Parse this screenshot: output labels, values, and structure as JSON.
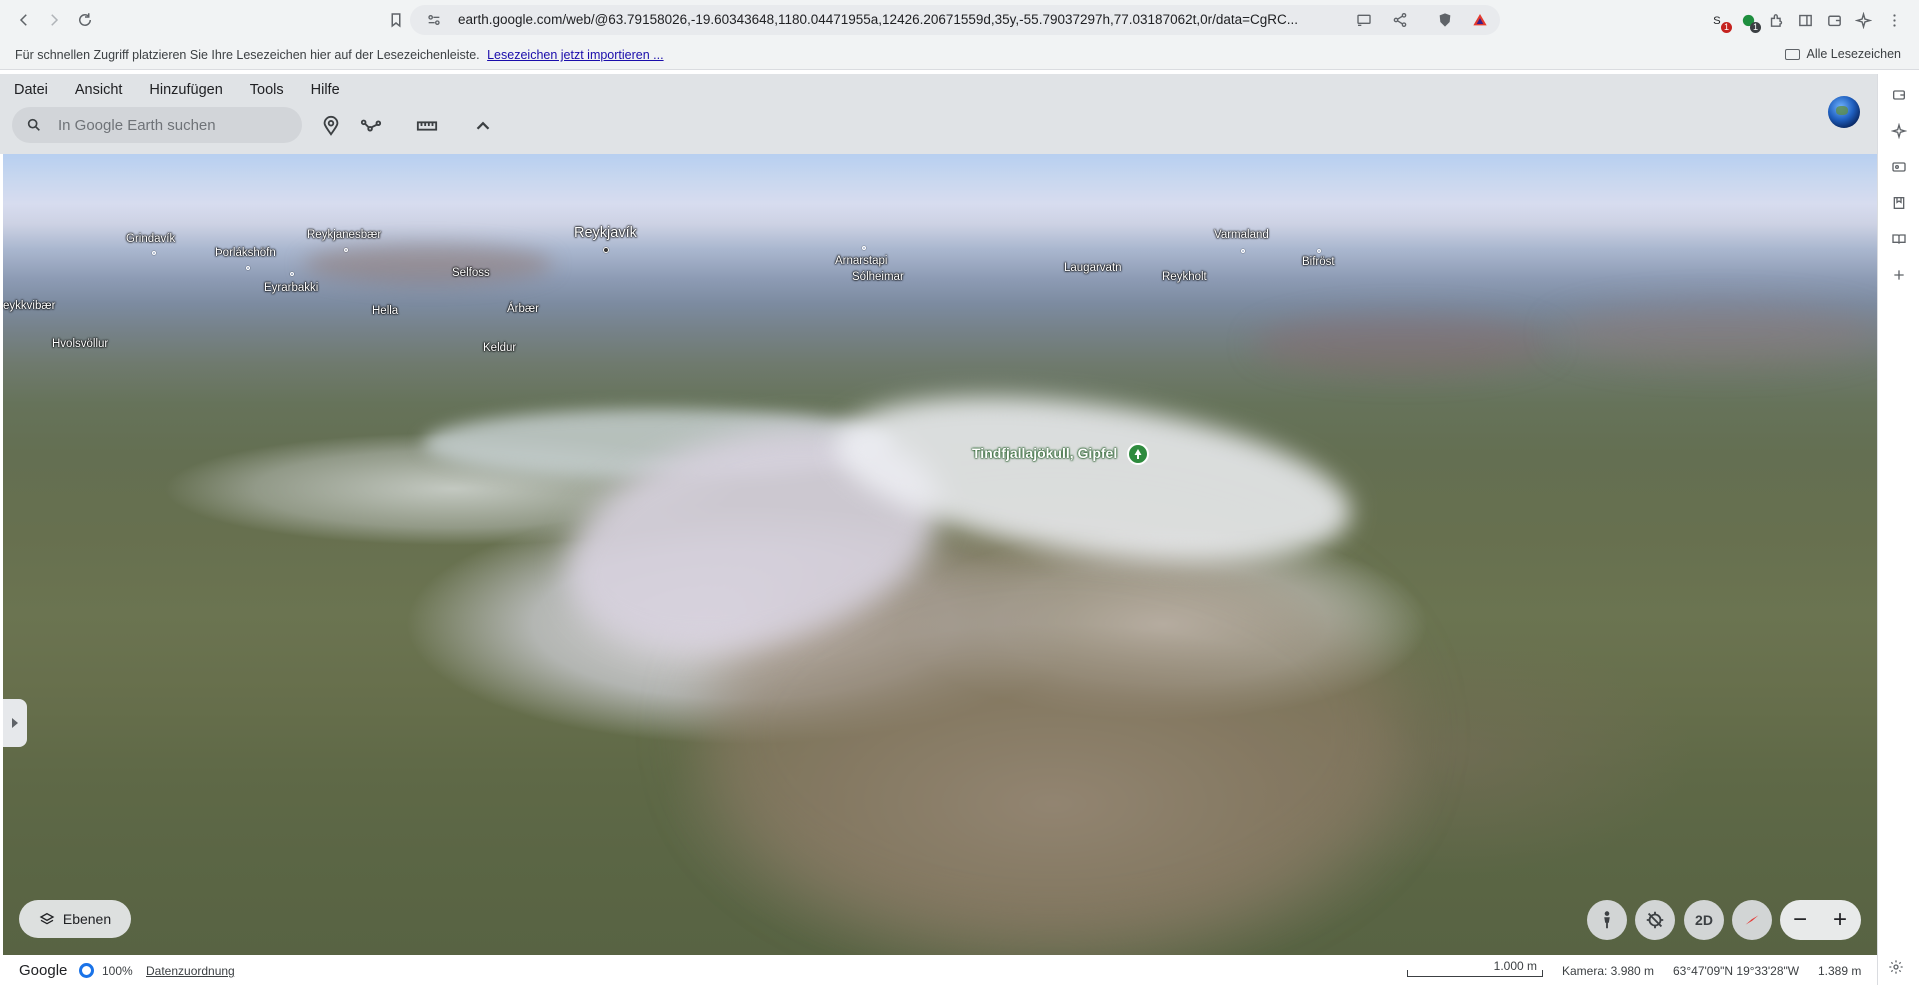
{
  "browser": {
    "url": "earth.google.com/web/@63.79158026,-19.60343648,1180.04471955a,12426.20671559d,35y,-55.79037297h,77.03187062t,0r/data=CgRC...",
    "extension_badges": [
      "1",
      "1"
    ],
    "bookmarks_bar": {
      "prompt": "Für schnellen Zugriff platzieren Sie Ihre Lesezeichen hier auf der Lesezeichenleiste.",
      "import_link": "Lesezeichen jetzt importieren ...",
      "all_bookmarks": "Alle Lesezeichen"
    }
  },
  "earth": {
    "menu": [
      "Datei",
      "Ansicht",
      "Hinzufügen",
      "Tools",
      "Hilfe"
    ],
    "search": {
      "placeholder": "In Google Earth suchen",
      "value": ""
    },
    "tools": [
      "placemark-icon",
      "path-icon",
      "ruler-icon",
      "collapse-icon"
    ],
    "places": [
      {
        "name": "Grindavík",
        "size": "small"
      },
      {
        "name": "Þorlákshöfn",
        "size": "small"
      },
      {
        "name": "Reykjanesbær",
        "size": "small"
      },
      {
        "name": "Reykjavík",
        "size": "large"
      },
      {
        "name": "Selfoss",
        "size": "small"
      },
      {
        "name": "Eyrarbakki",
        "size": "small"
      },
      {
        "name": "eykkvibær",
        "size": "small"
      },
      {
        "name": "Hella",
        "size": "small"
      },
      {
        "name": "Árbær",
        "size": "small"
      },
      {
        "name": "Hvolsvöllur",
        "size": "small"
      },
      {
        "name": "Keldur",
        "size": "small"
      },
      {
        "name": "Arnarstapi",
        "size": "small"
      },
      {
        "name": "Sólheimar",
        "size": "small"
      },
      {
        "name": "Laugarvatn",
        "size": "small"
      },
      {
        "name": "Reykholt",
        "size": "small"
      },
      {
        "name": "Varmaland",
        "size": "small"
      },
      {
        "name": "Bifröst",
        "size": "small"
      }
    ],
    "peak_label": "Tindfjallajökull, Gipfel",
    "layers_button": "Ebenen",
    "view_2d": "2D",
    "zoom_out": "−",
    "zoom_in": "+",
    "status": {
      "brand": "Google",
      "loading": "100%",
      "attribution": "Datenzuordnung",
      "scale": "1.000 m",
      "camera": "Kamera: 3.980 m",
      "coordinates": "63°47'09\"N 19°33'28\"W",
      "elevation": "1.389 m"
    }
  },
  "colors": {
    "pin_green": "#2e8b3e",
    "accent_blue": "#1a73e8",
    "header_bg": "#e0e3e6"
  }
}
